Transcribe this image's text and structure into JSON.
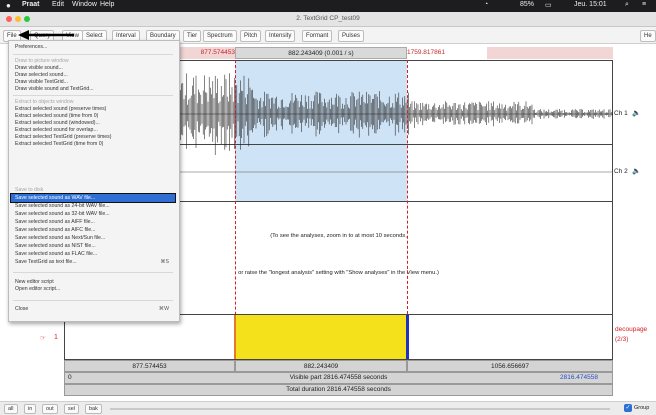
{
  "macos_menubar": {
    "app_name": "Praat",
    "items": [
      "Edit",
      "Window",
      "Help"
    ],
    "status": {
      "battery": "85%",
      "clock": "Jeu. 15:01"
    }
  },
  "window": {
    "title": "2. TextGrid CP_test09"
  },
  "toolbar": {
    "items": [
      "File",
      "Query",
      "View",
      "Select",
      "Interval",
      "Boundary",
      "Tier",
      "Spectrum",
      "Pitch",
      "Intensity",
      "Formant",
      "Pulses",
      "He"
    ]
  },
  "editor": {
    "top_bar": {
      "left_time": "877.574453",
      "center": "882.243409 (0.001 / s)",
      "right_time": "1759.817861"
    },
    "channels": [
      "Ch 1",
      "Ch 2"
    ],
    "message_line1": "(To see the analyses, zoom in to at most 10 seconds,",
    "message_line2": "or raise the \"longest analysis\" setting with \"Show analyses\" in the View menu.)",
    "tier_number": "1",
    "tier_name_line1": "decoupage",
    "tier_name_line2": "(2/3)",
    "bottom_row1": {
      "left": "877.574453",
      "center": "882.243409",
      "right": "1056.656697"
    },
    "bottom_row2": {
      "left": "0",
      "center": "Visible part 2816.474558 seconds",
      "right": "2816.474558"
    },
    "bottom_row3": {
      "center": "Total duration 2816.474558 seconds"
    }
  },
  "file_menu": {
    "items": [
      {
        "label": "Preferences...",
        "disabled": false
      },
      {
        "label": "Draw to picture window",
        "disabled": true
      },
      {
        "label": "Draw visible sound...",
        "disabled": false
      },
      {
        "label": "Draw selected sound...",
        "disabled": false
      },
      {
        "label": "Draw visible TextGrid...",
        "disabled": false
      },
      {
        "label": "Draw visible sound and TextGrid...",
        "disabled": false
      },
      {
        "label": "Extract to objects window",
        "disabled": true
      },
      {
        "label": "Extract selected sound (preserve times)",
        "disabled": false
      },
      {
        "label": "Extract selected sound (time from 0)",
        "disabled": false
      },
      {
        "label": "Extract selected sound (windowed)...",
        "disabled": false
      },
      {
        "label": "Extract selected sound for overlap...",
        "disabled": false
      },
      {
        "label": "Extract selected TextGrid (preserve times)",
        "disabled": false
      },
      {
        "label": "Extract selected TextGrid (time from 0)",
        "disabled": false
      },
      {
        "label": "Save to disk",
        "disabled": true
      },
      {
        "label": "Save selected sound as WAV file...",
        "disabled": false,
        "highlighted": true
      },
      {
        "label": "Save selected sound as 24-bit WAV file...",
        "disabled": false
      },
      {
        "label": "Save selected sound as 32-bit WAV file...",
        "disabled": false
      },
      {
        "label": "Save selected sound as AIFF file...",
        "disabled": false
      },
      {
        "label": "Save selected sound as AIFC file...",
        "disabled": false
      },
      {
        "label": "Save selected sound as Next/Sun file...",
        "disabled": false
      },
      {
        "label": "Save selected sound as NIST file...",
        "disabled": false
      },
      {
        "label": "Save selected sound as FLAC file...",
        "disabled": false
      },
      {
        "label": "Save TextGrid as text file...",
        "disabled": false,
        "shortcut": "⌘S"
      },
      {
        "label": "New editor script",
        "disabled": false
      },
      {
        "label": "Open editor script...",
        "disabled": false
      },
      {
        "label": "Close",
        "disabled": false,
        "shortcut": "⌘W"
      }
    ]
  },
  "bottom_bar": {
    "buttons": [
      "all",
      "in",
      "out",
      "sel",
      "bak"
    ],
    "group_label": "Group"
  },
  "colors": {
    "selection": "#cfe3f7",
    "interval_fill": "#f4e01b",
    "cursor_red": "#d21f1f",
    "boundary_blue": "#2033b8",
    "menu_highlight": "#2f6fd3",
    "annotation_arrow": "#000000"
  }
}
